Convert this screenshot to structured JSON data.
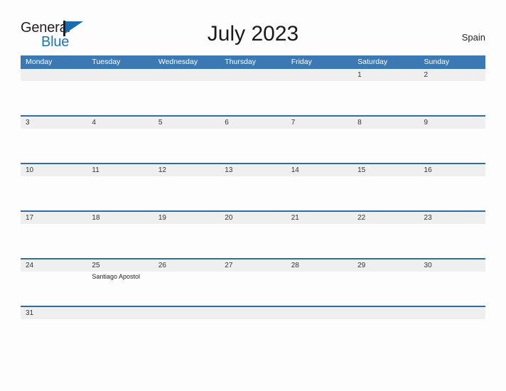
{
  "brand": {
    "name_part1": "General",
    "name_part2": "Blue",
    "flag_icon": "flag-triangle-icon"
  },
  "header": {
    "title": "July 2023",
    "country": "Spain"
  },
  "calendar": {
    "weekdays": [
      "Monday",
      "Tuesday",
      "Wednesday",
      "Thursday",
      "Friday",
      "Saturday",
      "Sunday"
    ],
    "weeks": [
      {
        "days": [
          {
            "num": "",
            "events": []
          },
          {
            "num": "",
            "events": []
          },
          {
            "num": "",
            "events": []
          },
          {
            "num": "",
            "events": []
          },
          {
            "num": "",
            "events": []
          },
          {
            "num": "1",
            "events": []
          },
          {
            "num": "2",
            "events": []
          }
        ]
      },
      {
        "days": [
          {
            "num": "3",
            "events": []
          },
          {
            "num": "4",
            "events": []
          },
          {
            "num": "5",
            "events": []
          },
          {
            "num": "6",
            "events": []
          },
          {
            "num": "7",
            "events": []
          },
          {
            "num": "8",
            "events": []
          },
          {
            "num": "9",
            "events": []
          }
        ]
      },
      {
        "days": [
          {
            "num": "10",
            "events": []
          },
          {
            "num": "11",
            "events": []
          },
          {
            "num": "12",
            "events": []
          },
          {
            "num": "13",
            "events": []
          },
          {
            "num": "14",
            "events": []
          },
          {
            "num": "15",
            "events": []
          },
          {
            "num": "16",
            "events": []
          }
        ]
      },
      {
        "days": [
          {
            "num": "17",
            "events": []
          },
          {
            "num": "18",
            "events": []
          },
          {
            "num": "19",
            "events": []
          },
          {
            "num": "20",
            "events": []
          },
          {
            "num": "21",
            "events": []
          },
          {
            "num": "22",
            "events": []
          },
          {
            "num": "23",
            "events": []
          }
        ]
      },
      {
        "days": [
          {
            "num": "24",
            "events": []
          },
          {
            "num": "25",
            "events": [
              "Santiago Apostol"
            ]
          },
          {
            "num": "26",
            "events": []
          },
          {
            "num": "27",
            "events": []
          },
          {
            "num": "28",
            "events": []
          },
          {
            "num": "29",
            "events": []
          },
          {
            "num": "30",
            "events": []
          }
        ]
      },
      {
        "days": [
          {
            "num": "31",
            "events": []
          },
          {
            "num": "",
            "events": []
          },
          {
            "num": "",
            "events": []
          },
          {
            "num": "",
            "events": []
          },
          {
            "num": "",
            "events": []
          },
          {
            "num": "",
            "events": []
          },
          {
            "num": "",
            "events": []
          }
        ]
      }
    ]
  },
  "colors": {
    "header_blue": "#3c79b4",
    "row_divider_blue": "#2e6da4",
    "daynum_band_gray": "#efefef",
    "brand_blue": "#1b75bc",
    "page_background": "#fdfdfd"
  }
}
